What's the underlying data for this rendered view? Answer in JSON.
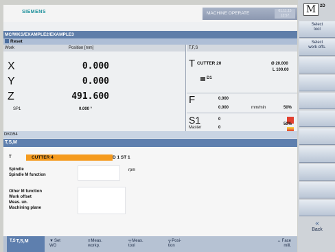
{
  "header": {
    "brand": "SIEMENS",
    "mode_title": "MACHINE OPERATE",
    "clock": "01.11.15\n13:57"
  },
  "path": "MC/WKS/EXAMPLE2/EXAMPLE3",
  "status": {
    "reset": "Reset"
  },
  "work": {
    "col_work": "Work",
    "col_position": "Position [mm]",
    "axes": [
      {
        "name": "X",
        "value": "0.000"
      },
      {
        "name": "Y",
        "value": "0.000"
      },
      {
        "name": "Z",
        "value": "491.600"
      }
    ],
    "spindle_label": "SP1",
    "spindle_value": "0.000 °"
  },
  "tfs": {
    "header": "T,F,S",
    "tool_letter": "T",
    "tool_name": "CUTTER 20",
    "radius": "Ø 20.000",
    "length": "L 100.00",
    "tool_pos": "D1",
    "feed_letter": "F",
    "feed_value1": "0.000",
    "feed_value2": "0.000",
    "feed_unit": "mm/min",
    "feed_pct": "50%",
    "spindle_letter": "S1",
    "spindle_value": "0",
    "master_label": "Master",
    "master_value": "0",
    "spindle_pct": "50%"
  },
  "program": {
    "name": "DKG54"
  },
  "tsm": {
    "title": "T,S,M",
    "t_label": "T",
    "tool_field": "CUTTER 4",
    "d_field": "D 1  ST  1",
    "spindle_label": "Spindle",
    "spindle_m_label": "Spindle M function",
    "rpm": "rpm",
    "other_m": "Other M function",
    "work_offset": "Work offset",
    "meas_unit": "Meas. un.",
    "machining_plane": "Machining plane",
    "more": ">"
  },
  "softkeys_h": [
    {
      "icon": "T,S",
      "label": "T,S,M"
    },
    {
      "icon": "▼",
      "label": "Set\nWO"
    },
    {
      "icon": "≡",
      "label": "Meas.\nworkp."
    },
    {
      "icon": "╤",
      "label": "Meas.\ntool"
    },
    {
      "icon": "╦",
      "label": "Posi-\ntion"
    },
    {
      "icon": "↔",
      "label": "Face\nmill."
    }
  ],
  "softkeys_v": {
    "m_key": "M",
    "key2": "2D",
    "select_tool": "Select\ntool",
    "select_wo": "Select\nwork offs.",
    "back": "Back",
    "back_arrow": "«"
  }
}
